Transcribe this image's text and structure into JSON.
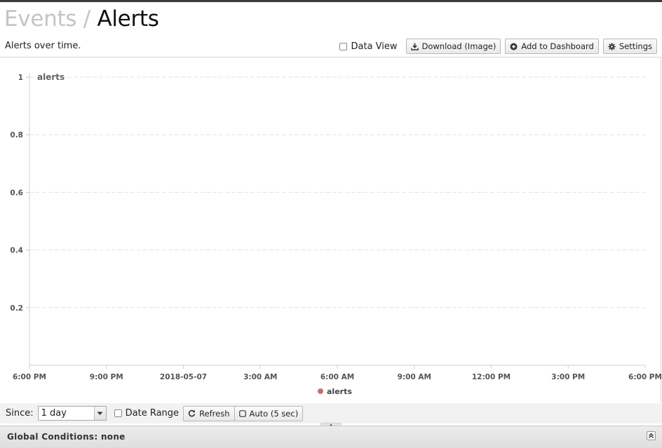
{
  "header": {
    "breadcrumb_parent": "Events",
    "separator": "/",
    "title": "Alerts"
  },
  "subtitle": "Alerts over time.",
  "toolbar": {
    "data_view_label": "Data View",
    "data_view_checked": false,
    "download_label": "Download (Image)",
    "add_dashboard_label": "Add to Dashboard",
    "settings_label": "Settings",
    "icons": [
      "download-icon",
      "plus-circle-icon",
      "gear-icon"
    ]
  },
  "chart_data": {
    "type": "line",
    "title": "",
    "xlabel": "",
    "ylabel": "",
    "x_ticks": [
      "6:00 PM",
      "9:00 PM",
      "2018-05-07",
      "3:00 AM",
      "6:00 AM",
      "9:00 AM",
      "12:00 PM",
      "3:00 PM",
      "6:00 PM"
    ],
    "y_ticks": [
      "0.2",
      "0.4",
      "0.6",
      "0.8",
      "1"
    ],
    "y_tick_values": [
      0.2,
      0.4,
      0.6,
      0.8,
      1
    ],
    "ylim": [
      0,
      1
    ],
    "grid": true,
    "legend_position": "bottom-center",
    "series": [
      {
        "name": "alerts",
        "color": "#c07272",
        "values": []
      }
    ],
    "annotation": "alerts"
  },
  "controls": {
    "since_label": "Since:",
    "since_value": "1 day",
    "date_range_label": "Date Range",
    "date_range_checked": false,
    "refresh_label": "Refresh",
    "auto_label": "Auto (5 sec)",
    "icons": [
      "refresh-icon",
      "square-icon",
      "chevron-down-icon"
    ]
  },
  "global_conditions": {
    "text": "Global Conditions: none",
    "icon": "chevron-double-up-icon"
  }
}
